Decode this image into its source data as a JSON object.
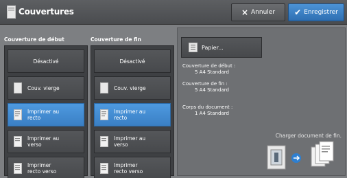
{
  "header": {
    "title": "Couvertures",
    "cancel_label": "Annuler",
    "save_label": "Enregistrer",
    "cancel_icon": "×",
    "save_icon": "✔"
  },
  "columns": {
    "start": {
      "heading": "Couverture de début",
      "options": [
        {
          "label": "Désactivé"
        },
        {
          "label": "Couv. vierge"
        },
        {
          "label": "Imprimer au recto"
        },
        {
          "label": "Imprimer au verso"
        },
        {
          "label": "Imprimer recto verso"
        }
      ]
    },
    "end": {
      "heading": "Couverture de fin",
      "options": [
        {
          "label": "Désactivé"
        },
        {
          "label": "Couv. vierge"
        },
        {
          "label": "Imprimer au recto"
        },
        {
          "label": "Imprimer au verso"
        },
        {
          "label": "Imprimer recto verso"
        }
      ]
    }
  },
  "panel": {
    "paper_label": "Papier...",
    "start_cover": {
      "label": "Couverture de début :",
      "value": "5 A4 Standard"
    },
    "end_cover": {
      "label": "Couverture de fin :",
      "value": "5 A4 Standard"
    },
    "body": {
      "label": "Corps du document :",
      "value": "1 A4 Standard"
    },
    "load_text": "Charger document de fin."
  },
  "colors": {
    "accent": "#3a7fc4",
    "background": "#7d7f82",
    "panel": "#6e7073"
  }
}
